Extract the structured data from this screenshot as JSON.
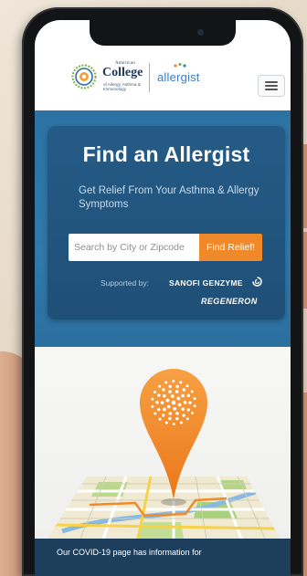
{
  "header": {
    "logo": {
      "icon": "college-seal-icon",
      "overline": "American",
      "title": "College",
      "subtitle": "of Allergy, Asthma & Immunology"
    },
    "partner_logo": "allergist",
    "partner_icon": "allergist-mark-icon",
    "menu_icon": "hamburger-menu-icon"
  },
  "hero": {
    "title": "Find an Allergist",
    "subtitle": "Get Relief From Your Asthma & Allergy Symptoms",
    "search": {
      "placeholder": "Search by City or Zipcode",
      "value": "",
      "button_label": "Find Relief!"
    },
    "sponsors": {
      "label": "Supported by:",
      "primary": "SANOFI GENZYME",
      "primary_icon": "sanofi-swirl-icon",
      "secondary": "REGENERON"
    }
  },
  "illustration": {
    "pin_icon": "map-pin-icon",
    "map_icon": "city-map-icon"
  },
  "banner": {
    "text": "Our COVID-19 page has information for"
  },
  "colors": {
    "hero_blue": "#2f79ab",
    "card_blue": "#245b86",
    "accent_orange": "#f0892a",
    "banner_navy": "#1e3f5c",
    "partner_blue": "#3c7fc4"
  }
}
